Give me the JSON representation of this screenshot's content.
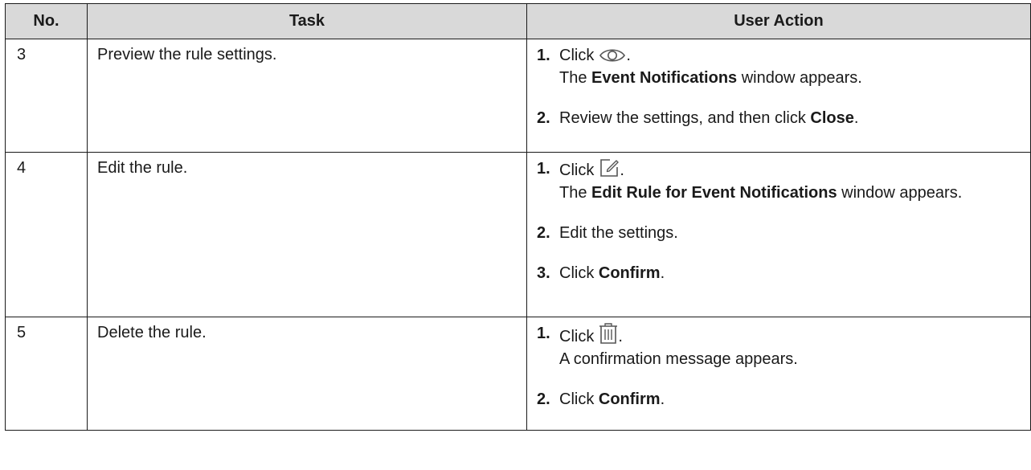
{
  "headers": {
    "no": "No.",
    "task": "Task",
    "action": "User Action"
  },
  "rows": [
    {
      "no": "3",
      "task": "Preview the rule settings.",
      "steps": [
        {
          "num": "1.",
          "click": "Click",
          "icon": "eye-icon",
          "after_icon": ".",
          "pre": "The ",
          "bold": "Event Notifications",
          "post": " window appears."
        },
        {
          "num": "2.",
          "pre": "Review the settings, and then click ",
          "bold": "Close",
          "post": "."
        }
      ]
    },
    {
      "no": "4",
      "task": "Edit the rule.",
      "steps": [
        {
          "num": "1.",
          "click": "Click",
          "icon": "edit-icon",
          "after_icon": ".",
          "pre": "The ",
          "bold": "Edit Rule for Event Notifications",
          "post": " window appears."
        },
        {
          "num": "2.",
          "text": "Edit the settings."
        },
        {
          "num": "3.",
          "pre": "Click ",
          "bold": "Confirm",
          "post": "."
        }
      ]
    },
    {
      "no": "5",
      "task": "Delete the rule.",
      "steps": [
        {
          "num": "1.",
          "click": "Click",
          "icon": "trash-icon",
          "after_icon": ".",
          "text": "A confirmation message appears."
        },
        {
          "num": "2.",
          "pre": "Click ",
          "bold": "Confirm",
          "post": "."
        }
      ]
    }
  ]
}
